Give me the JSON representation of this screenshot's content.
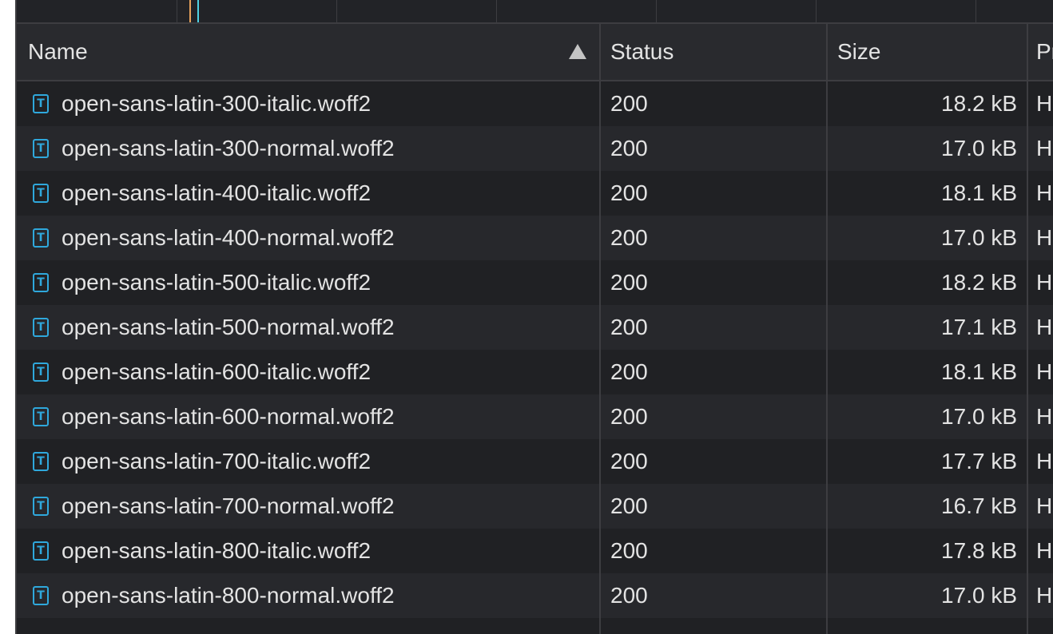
{
  "header": {
    "name": "Name",
    "status": "Status",
    "size": "Size",
    "protocol": "Pr"
  },
  "rows": [
    {
      "name": "open-sans-latin-300-italic.woff2",
      "status": "200",
      "size": "18.2 kB",
      "protocol": "H"
    },
    {
      "name": "open-sans-latin-300-normal.woff2",
      "status": "200",
      "size": "17.0 kB",
      "protocol": "H"
    },
    {
      "name": "open-sans-latin-400-italic.woff2",
      "status": "200",
      "size": "18.1 kB",
      "protocol": "H"
    },
    {
      "name": "open-sans-latin-400-normal.woff2",
      "status": "200",
      "size": "17.0 kB",
      "protocol": "H"
    },
    {
      "name": "open-sans-latin-500-italic.woff2",
      "status": "200",
      "size": "18.2 kB",
      "protocol": "H"
    },
    {
      "name": "open-sans-latin-500-normal.woff2",
      "status": "200",
      "size": "17.1 kB",
      "protocol": "H"
    },
    {
      "name": "open-sans-latin-600-italic.woff2",
      "status": "200",
      "size": "18.1 kB",
      "protocol": "H"
    },
    {
      "name": "open-sans-latin-600-normal.woff2",
      "status": "200",
      "size": "17.0 kB",
      "protocol": "H"
    },
    {
      "name": "open-sans-latin-700-italic.woff2",
      "status": "200",
      "size": "17.7 kB",
      "protocol": "H"
    },
    {
      "name": "open-sans-latin-700-normal.woff2",
      "status": "200",
      "size": "16.7 kB",
      "protocol": "H"
    },
    {
      "name": "open-sans-latin-800-italic.woff2",
      "status": "200",
      "size": "17.8 kB",
      "protocol": "H"
    },
    {
      "name": "open-sans-latin-800-normal.woff2",
      "status": "200",
      "size": "17.0 kB",
      "protocol": "H"
    }
  ],
  "icons": {
    "row_icon": "font-file-icon",
    "row_icon_glyph": "T",
    "sort": "sort-ascending-icon"
  },
  "colors": {
    "background": "#202124",
    "row_alt": "#27282c",
    "text": "#e3e3e3",
    "icon_accent": "#2fa8dc",
    "overview_marker_orange": "#e8a25c",
    "overview_marker_cyan": "#4fd1e3"
  }
}
